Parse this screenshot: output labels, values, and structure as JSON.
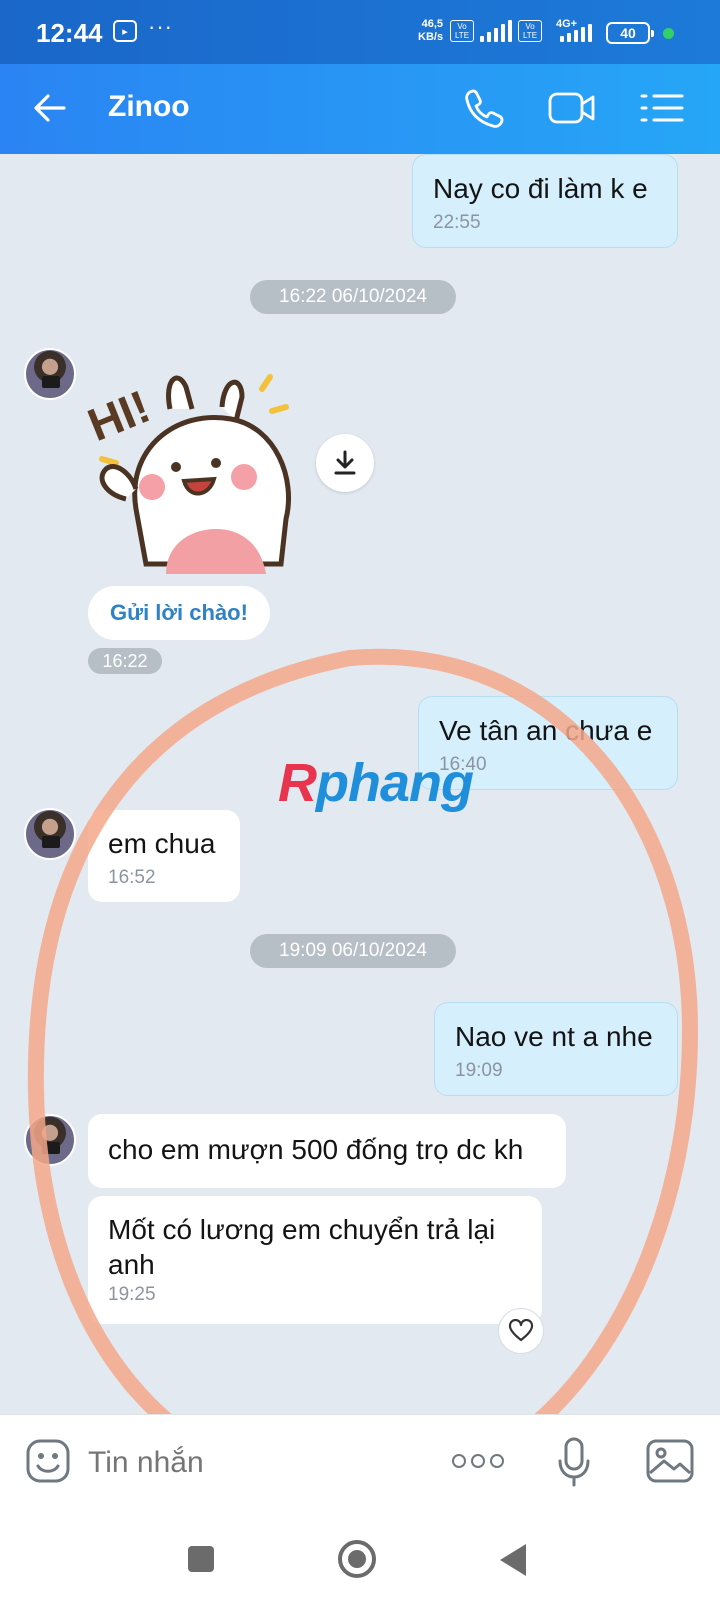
{
  "status_bar": {
    "time": "12:44",
    "dots": "···",
    "speed_value": "46,5",
    "speed_unit": "KB/s",
    "sim1_label": "Vo LTE",
    "sim2_label": "Vo LTE",
    "network_type": "4G+",
    "battery": "40"
  },
  "header": {
    "title": "Zinoo"
  },
  "chat": {
    "messages": [
      {
        "direction": "out",
        "text": "Nay co đi làm k e",
        "time": "22:55"
      },
      {
        "direction": "out",
        "text": "Ve tân an chưa e",
        "time": "16:40"
      },
      {
        "direction": "in",
        "text": "em chua",
        "time": "16:52"
      },
      {
        "direction": "out",
        "text": "Nao ve nt a nhe",
        "time": "19:09"
      },
      {
        "direction": "in",
        "text": "cho em mượn 500 đống trọ dc kh"
      },
      {
        "direction": "in",
        "text": "Mốt có lương em chuyển trả lại anh",
        "time": "19:25"
      }
    ],
    "date_separators": [
      "16:22 06/10/2024",
      "19:09 06/10/2024"
    ],
    "sticker": {
      "text": "HI!",
      "time": "16:22"
    },
    "greet_button": "Gửi lời chào!"
  },
  "watermark": {
    "part1": "R",
    "part2": "phang"
  },
  "input": {
    "placeholder": "Tin nhắn"
  },
  "colors": {
    "header_blue": "#2a84f3",
    "outgoing_bubble": "#d5effd",
    "incoming_bubble": "#ffffff",
    "chat_bg": "#e2e9f1",
    "annotation_circle": "#f4a78a"
  },
  "icons": [
    "back-arrow-icon",
    "phone-icon",
    "video-call-icon",
    "menu-list-icon",
    "download-icon",
    "heart-icon",
    "emoji-icon",
    "more-icon",
    "mic-icon",
    "image-icon"
  ]
}
